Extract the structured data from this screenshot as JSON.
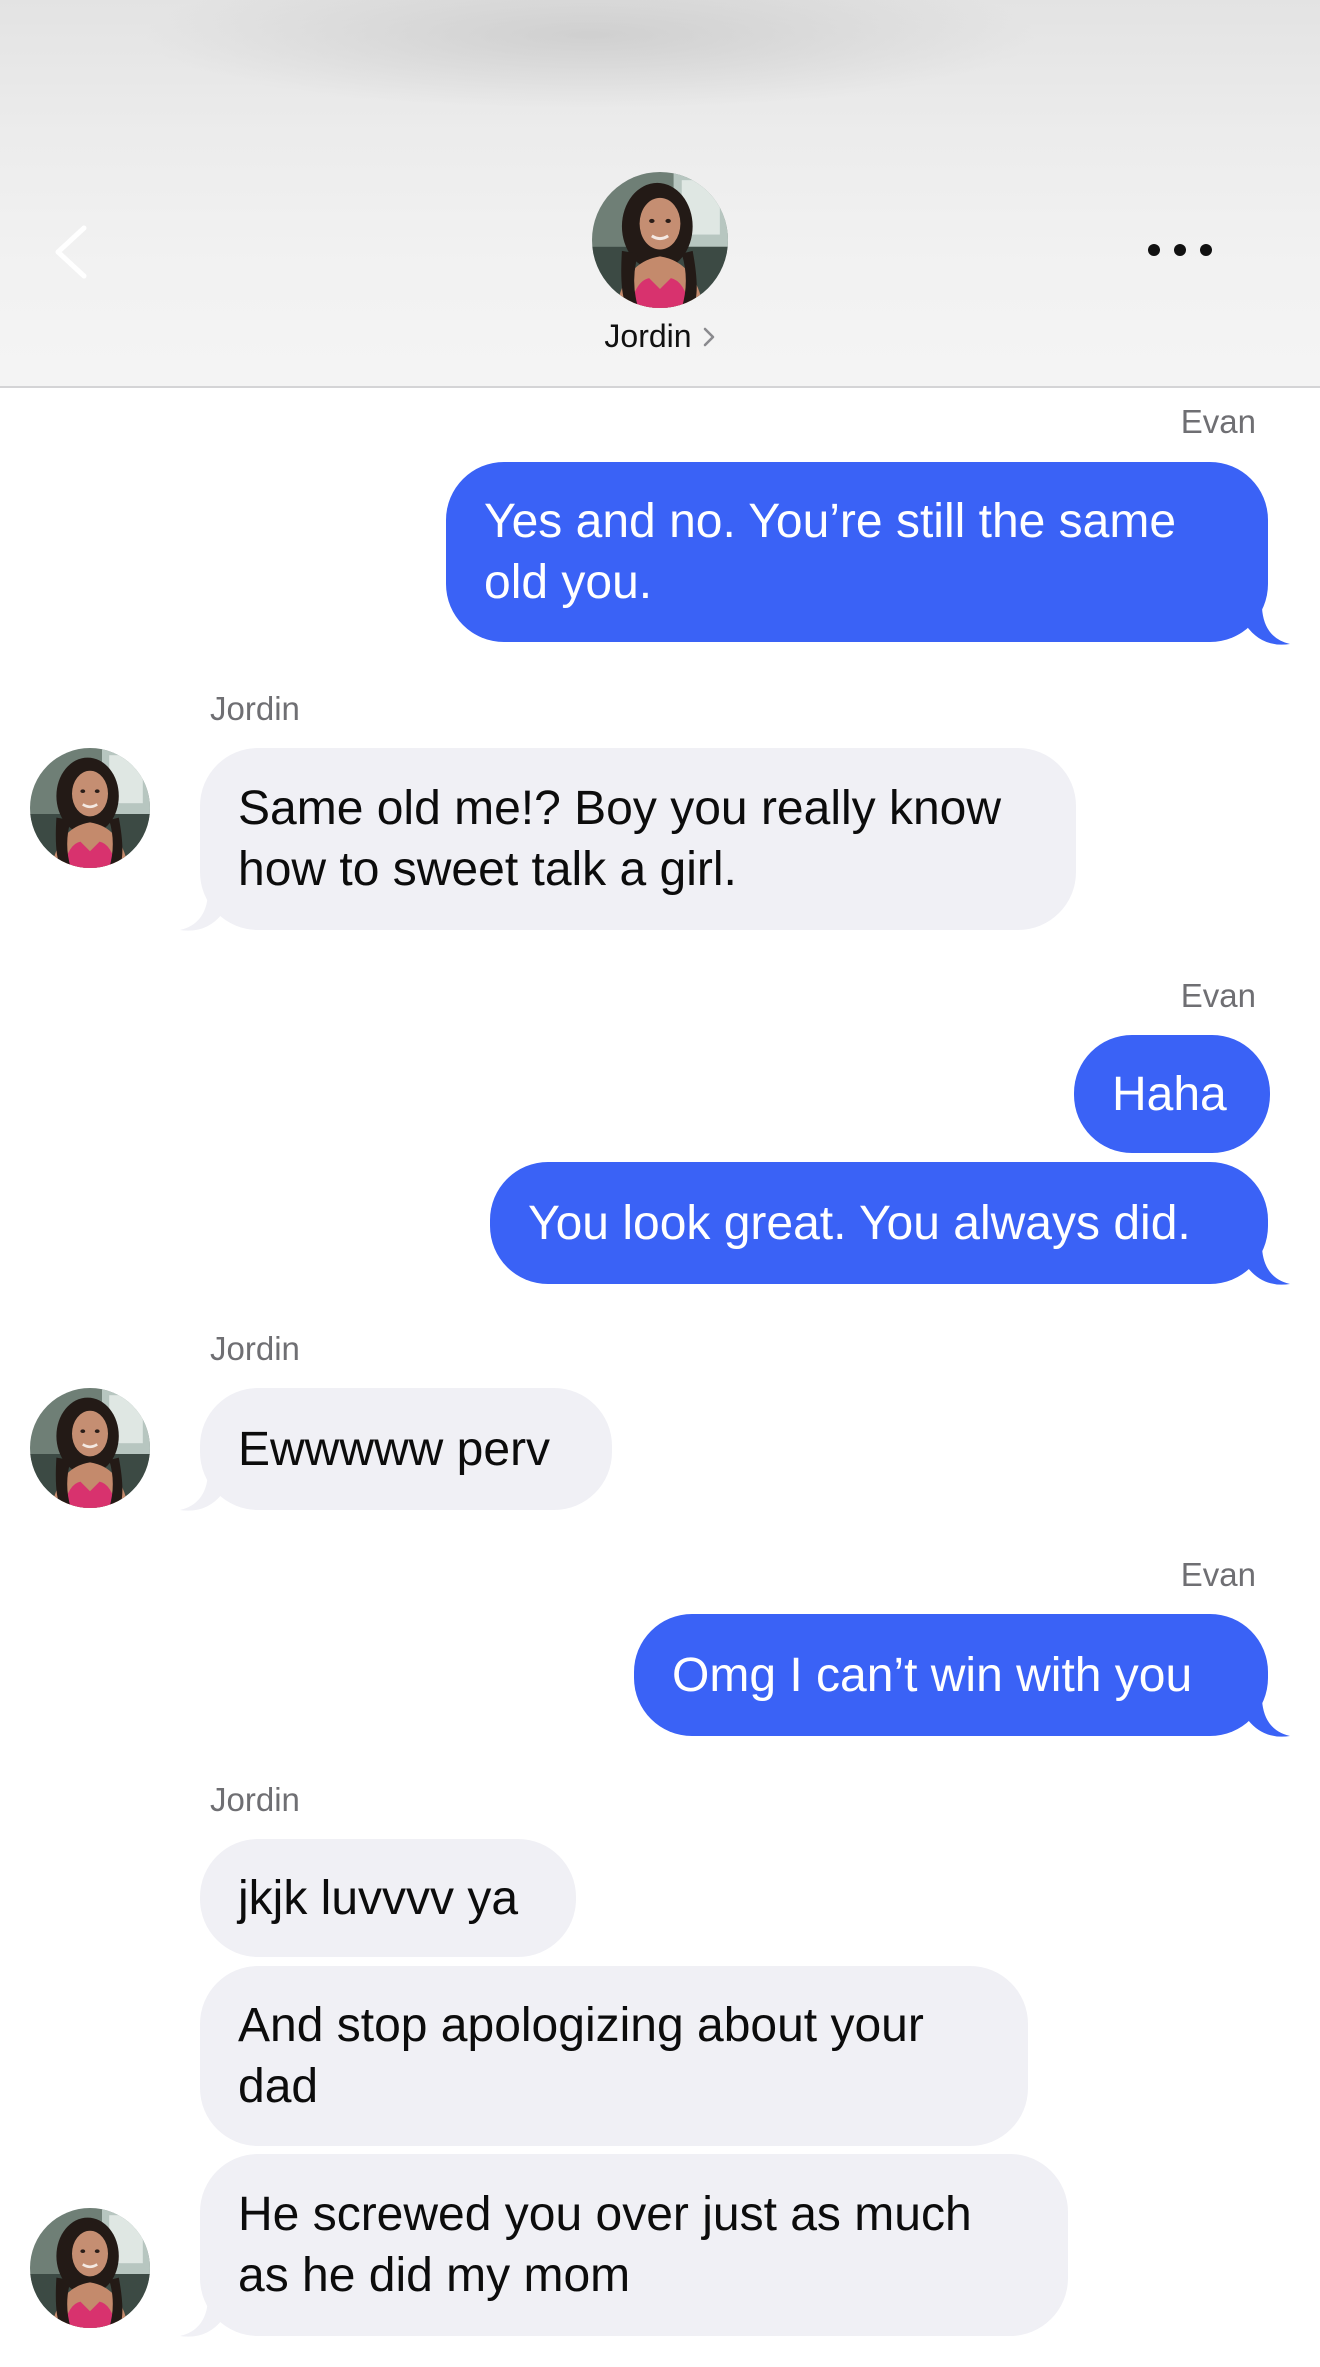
{
  "header": {
    "contact_name": "Jordin",
    "back_icon": "chevron-left-icon",
    "more_icon": "more-horizontal-icon"
  },
  "colors": {
    "outgoing_bubble": "#3a62f6",
    "incoming_bubble": "#f0f0f5",
    "sender_label": "#6f6f73"
  },
  "messages": [
    {
      "sender": "Evan",
      "direction": "out",
      "text": "Yes and no. You’re still the same old you."
    },
    {
      "sender": "Jordin",
      "direction": "in",
      "text": "Same old me!? Boy you really know how to sweet talk a girl."
    },
    {
      "sender": "Evan",
      "direction": "out",
      "text": "Haha"
    },
    {
      "sender": "Evan",
      "direction": "out",
      "text": "You look great. You always did."
    },
    {
      "sender": "Jordin",
      "direction": "in",
      "text": "Ewwwww perv"
    },
    {
      "sender": "Evan",
      "direction": "out",
      "text": "Omg I can’t win with you"
    },
    {
      "sender": "Jordin",
      "direction": "in",
      "text": "jkjk luvvvv ya"
    },
    {
      "sender": "Jordin",
      "direction": "in",
      "text": "And stop apologizing about your dad"
    },
    {
      "sender": "Jordin",
      "direction": "in",
      "text": "He screwed you over just as much as he did my mom"
    }
  ]
}
